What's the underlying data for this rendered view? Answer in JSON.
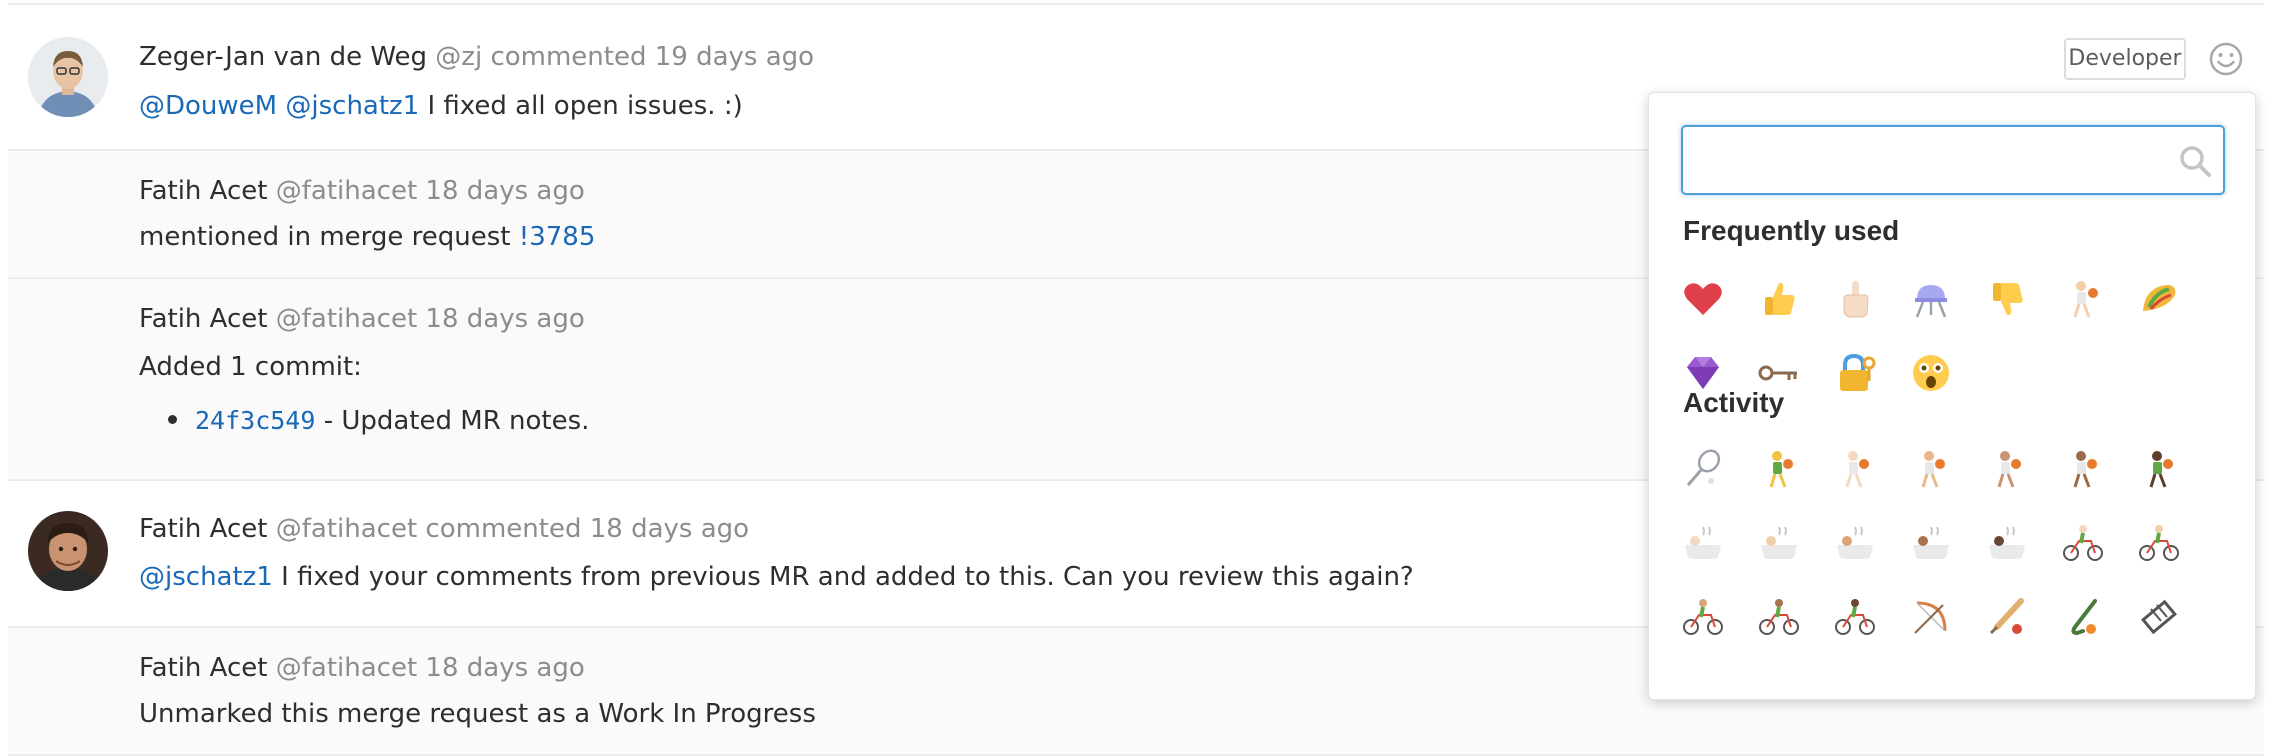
{
  "notes": [
    {
      "author": "Zeger-Jan van de Weg",
      "handle": "@zj",
      "action": "commented",
      "time": "19 days ago",
      "mention1": "@DouweM",
      "mention2": "@jschatz1",
      "body": "I fixed all open issues. :)",
      "role": "Developer"
    },
    {
      "author": "Fatih Acet",
      "handle": "@fatihacet",
      "time": "18 days ago",
      "body": "mentioned in merge request",
      "mr_ref": "!3785"
    },
    {
      "author": "Fatih Acet",
      "handle": "@fatihacet",
      "time": "18 days ago",
      "body": "Added 1 commit:",
      "commit_sha": "24f3c549",
      "commit_message": "- Updated MR notes."
    },
    {
      "author": "Fatih Acet",
      "handle": "@fatihacet",
      "action": "commented",
      "time": "18 days ago",
      "mention": "@jschatz1",
      "body": "I fixed your comments from previous MR and added to this. Can you review this again?"
    },
    {
      "author": "Fatih Acet",
      "handle": "@fatihacet",
      "time": "18 days ago",
      "body": "Unmarked this merge request as a Work In Progress"
    }
  ],
  "emoji_menu": {
    "search_placeholder": "",
    "sections": [
      {
        "title": "Frequently used",
        "emojis": [
          "heart",
          "thumbsup",
          "middle-finger",
          "bbq-grill",
          "thumbsdown",
          "basketball-player",
          "taco",
          "gem",
          "old-key",
          "closed-lock-with-key",
          "astonished-face"
        ]
      },
      {
        "title": "Activity",
        "emojis": [
          "badminton",
          "basketball-player-tone1",
          "basketball-player-tone2",
          "basketball-player-tone3",
          "basketball-player-tone4",
          "basketball-player-tone5",
          "basketball-player-tone6",
          "bath-tone1",
          "bath-tone2",
          "bath-tone3",
          "bath-tone4",
          "bath-tone5",
          "bicyclist-tone1",
          "bicyclist-tone2",
          "bicyclist-tone3",
          "bicyclist-tone4",
          "bicyclist-tone5",
          "bow-and-arrow",
          "cricket",
          "field-hockey",
          "film-frames"
        ]
      }
    ]
  },
  "colors": {
    "link": "#1b69b6",
    "meta": "#8c8c8c",
    "text": "#2e2e2e",
    "focus": "#4aa0d8"
  }
}
